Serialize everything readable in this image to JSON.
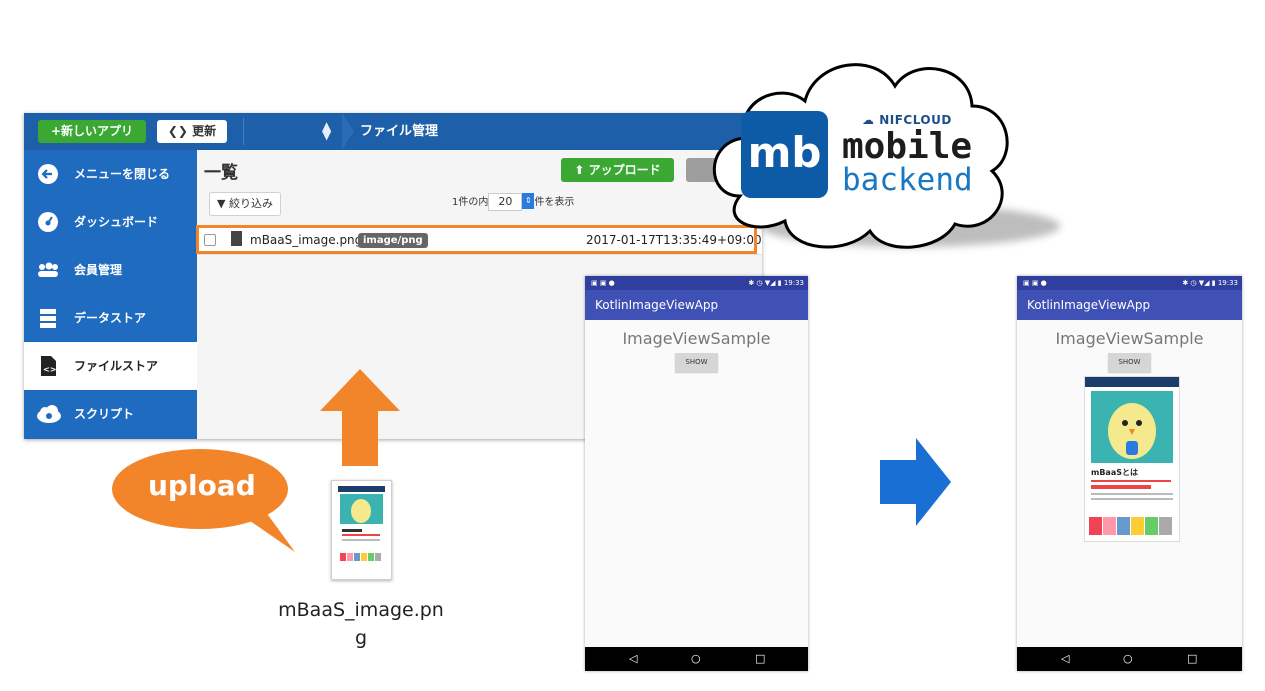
{
  "console": {
    "new_app_button": "+新しいアプリ",
    "refresh_button": "更新",
    "breadcrumb": "ファイル管理",
    "sidebar": [
      {
        "icon": "arrow-left-circle-icon",
        "label": "メニューを閉じる"
      },
      {
        "icon": "dashboard-icon",
        "label": "ダッシュボード"
      },
      {
        "icon": "users-icon",
        "label": "会員管理"
      },
      {
        "icon": "database-icon",
        "label": "データストア"
      },
      {
        "icon": "file-code-icon",
        "label": "ファイルストア"
      },
      {
        "icon": "cloud-gear-icon",
        "label": "スクリプト"
      }
    ],
    "list_title": "一覧",
    "upload_button": "アップロード",
    "filter_button": "絞り込み",
    "pager": {
      "prefix": "1件の内",
      "count": "20",
      "suffix": "件を表示"
    },
    "file_row": {
      "name": "mBaaS_image.png",
      "type": "image/png",
      "date": "2017-01-17T13:35:49+09:00"
    }
  },
  "logo": {
    "nifcloud": "NIFCLOUD",
    "mobile": "mobile",
    "backend": "backend",
    "mark": "mb"
  },
  "upload_bubble": "upload",
  "thumbnail": {
    "name_line1": "mBaaS_image.pn",
    "name_line2": "g"
  },
  "phone_left": {
    "status_time": "19:33",
    "app_title": "KotlinImageViewApp",
    "sample_title": "ImageViewSample",
    "show_button": "SHOW"
  },
  "phone_right": {
    "status_time": "19:33",
    "app_title": "KotlinImageViewApp",
    "sample_title": "ImageViewSample",
    "show_button": "SHOW",
    "poster_text": "mBaaSとは"
  },
  "colors": {
    "accent_orange": "#f2842a",
    "console_blue": "#1d5fa8",
    "android_indigo": "#3f51b5",
    "green": "#3aa832"
  }
}
